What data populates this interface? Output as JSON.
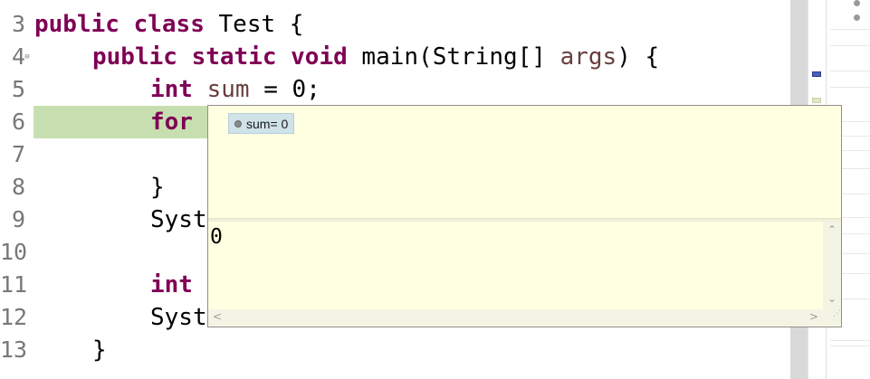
{
  "editor": {
    "lines": [
      {
        "num": "3",
        "tokens": [
          {
            "t": "public",
            "c": "kw"
          },
          {
            "t": " "
          },
          {
            "t": "class",
            "c": "kw"
          },
          {
            "t": " Test {"
          }
        ],
        "indent": 0
      },
      {
        "num": "4",
        "tokens": [
          {
            "t": "public",
            "c": "kw"
          },
          {
            "t": " "
          },
          {
            "t": "static",
            "c": "kw"
          },
          {
            "t": " "
          },
          {
            "t": "void",
            "c": "kw"
          },
          {
            "t": " main(String[] "
          },
          {
            "t": "args",
            "c": "var"
          },
          {
            "t": ") {"
          }
        ],
        "indent": 1,
        "fold": "⊖"
      },
      {
        "num": "5",
        "tokens": [
          {
            "t": "int",
            "c": "kw"
          },
          {
            "t": " "
          },
          {
            "t": "sum",
            "c": "var"
          },
          {
            "t": " = 0;"
          }
        ],
        "indent": 2
      },
      {
        "num": "6",
        "tokens": [
          {
            "t": "for",
            "c": "kw"
          }
        ],
        "indent": 2
      },
      {
        "num": "7",
        "tokens": [],
        "indent": 2
      },
      {
        "num": "8",
        "tokens": [
          {
            "t": "}"
          }
        ],
        "indent": 2
      },
      {
        "num": "9",
        "tokens": [
          {
            "t": "Syst"
          }
        ],
        "indent": 2
      },
      {
        "num": "10",
        "tokens": [],
        "indent": 2
      },
      {
        "num": "11",
        "tokens": [
          {
            "t": "int",
            "c": "kw"
          }
        ],
        "indent": 2
      },
      {
        "num": "12",
        "tokens": [
          {
            "t": "Syst"
          }
        ],
        "indent": 2
      },
      {
        "num": "13",
        "tokens": [
          {
            "t": "}"
          }
        ],
        "indent": 1
      }
    ]
  },
  "popup": {
    "variable_label": "sum= 0",
    "variable_icon": "field-icon",
    "detail_value": "0",
    "scroll_up": "⌃",
    "scroll_down": "⌄",
    "scroll_left": "<",
    "scroll_right": ">"
  },
  "colors": {
    "keyword": "#7f0055",
    "variable": "#6a3e3e",
    "current_line_highlight": "#c7dfb0",
    "popup_background": "#ffffe1",
    "chip_background": "#cfe3e9"
  }
}
